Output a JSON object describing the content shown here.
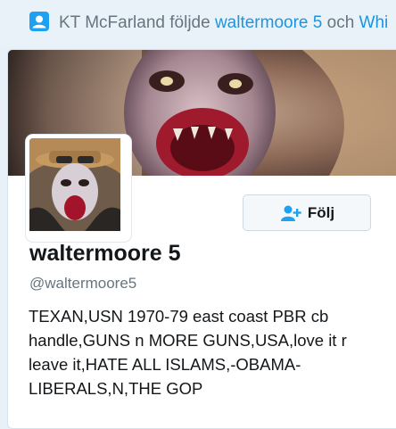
{
  "context": {
    "icon": "person-icon",
    "actor": "KT McFarland",
    "action": " följde ",
    "target1": "waltermoore 5",
    "conjunction": " och ",
    "target2": "Whi"
  },
  "card": {
    "banner_image": "banner-image",
    "avatar_image": "avatar-image",
    "follow_button": {
      "label": "Följ",
      "icon": "add-user-icon"
    },
    "name": "waltermoore 5",
    "handle": "@waltermoore5",
    "bio": "TEXAN,USN 1970-79 east coast PBR cb handle,GUNS n MORE GUNS,USA,love it r leave it,HATE ALL ISLAMS,-OBAMA-LIBERALS,N,THE GOP"
  },
  "colors": {
    "link": "#1b95e0",
    "muted": "#66757f",
    "text": "#14171a",
    "button_bg": "#f5f8fa"
  }
}
